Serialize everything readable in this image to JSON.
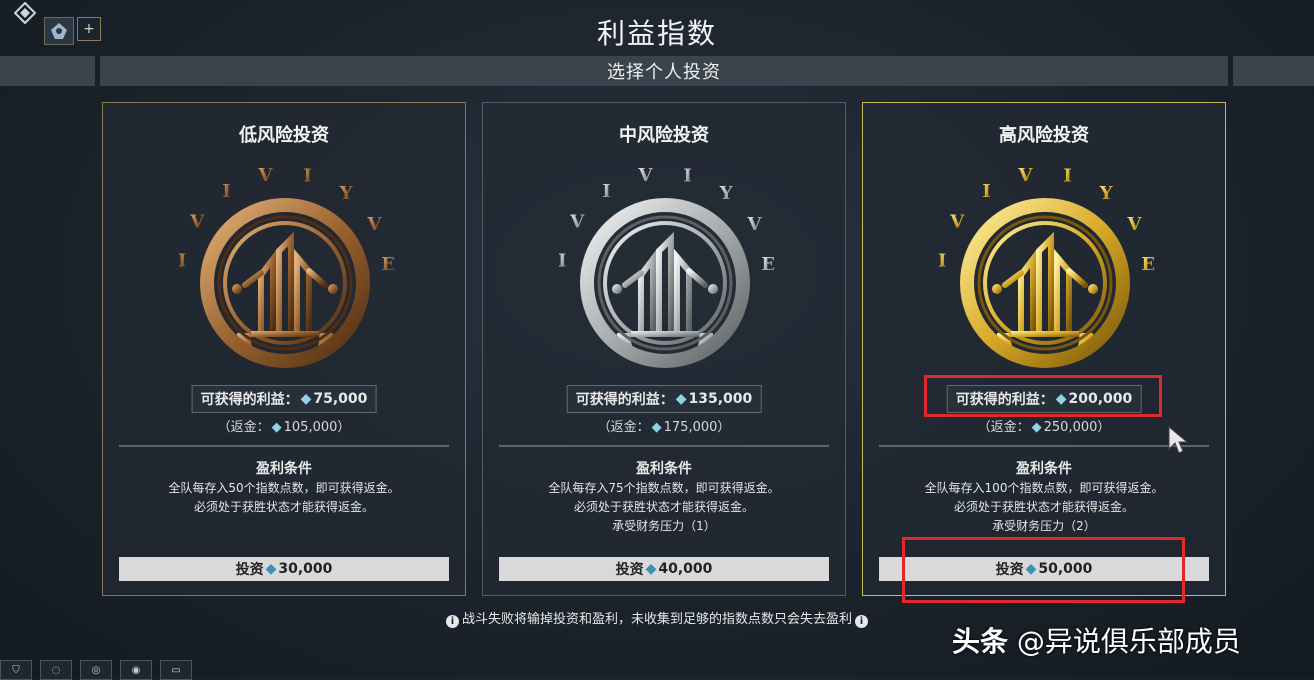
{
  "header": {
    "title": "利益指数",
    "subtitle": "选择个人投资",
    "add_label": "+"
  },
  "cards": [
    {
      "title": "低风险投资",
      "profit_label": "可获得的利益：",
      "profit_value": "75,000",
      "rebate_open": "（返金：",
      "rebate_value": "105,000）",
      "cond_title": "盈利条件",
      "lines": [
        "全队每存入50个指数点数，即可获得返金。",
        "必须处于获胜状态才能获得返金。",
        ""
      ],
      "invest_label": "投资",
      "invest_value": "30,000",
      "medal_colors": [
        "#e3b27a",
        "#9a6330",
        "#4e2d12"
      ]
    },
    {
      "title": "中风险投资",
      "profit_label": "可获得的利益：",
      "profit_value": "135,000",
      "rebate_open": "（返金：",
      "rebate_value": "175,000）",
      "cond_title": "盈利条件",
      "lines": [
        "全队每存入75个指数点数，即可获得返金。",
        "必须处于获胜状态才能获得返金。",
        "承受财务压力（1）"
      ],
      "invest_label": "投资",
      "invest_value": "40,000",
      "medal_colors": [
        "#f2f2f2",
        "#a8adb0",
        "#5b6063"
      ]
    },
    {
      "title": "高风险投资",
      "profit_label": "可获得的利益：",
      "profit_value": "200,000",
      "rebate_open": "（返金：",
      "rebate_value": "250,000）",
      "cond_title": "盈利条件",
      "lines": [
        "全队每存入100个指数点数，即可获得返金。",
        "必须处于获胜状态才能获得返金。",
        "承受财务压力（2）"
      ],
      "invest_label": "投资",
      "invest_value": "50,000",
      "medal_colors": [
        "#fff0a0",
        "#d8aa28",
        "#7a5608"
      ]
    }
  ],
  "footer": {
    "note": "战斗失败将输掉投资和盈利，未收集到足够的指数点数只会失去盈利"
  },
  "watermark": {
    "brand": "头条",
    "handle": "@异说俱乐部成员"
  },
  "icons": {
    "platinum": "platinum-icon",
    "info": "info-icon"
  },
  "colors": {
    "highlight": "#e02a2a",
    "low_border": "#8a7a4a",
    "high_border": "#c9b95a"
  }
}
